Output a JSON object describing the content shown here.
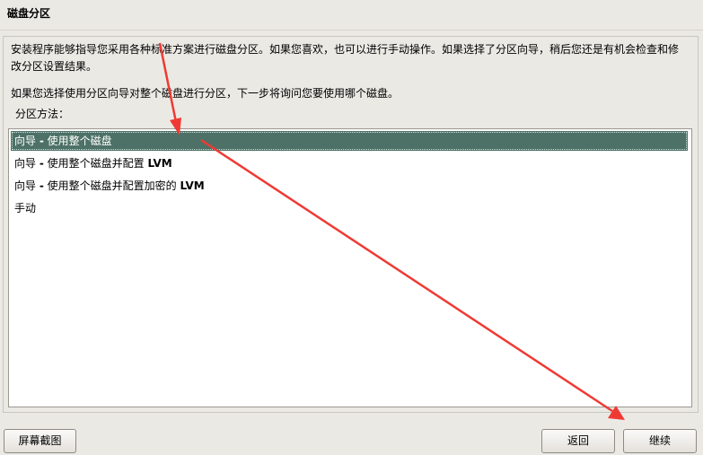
{
  "window": {
    "title": "磁盘分区"
  },
  "description": {
    "line1": "安装程序能够指导您采用各种标准方案进行磁盘分区。如果您喜欢，也可以进行手动操作。如果选择了分区向导，稍后您还是有机会检查和修",
    "line2": "改分区设置结果。",
    "line3": "如果您选择使用分区向导对整个磁盘进行分区，下一步将询问您要使用哪个磁盘。"
  },
  "method_label": "分区方法：",
  "options": [
    {
      "prefix": "向导 ",
      "dash": "-",
      "text": " 使用整个磁盘",
      "suffix": "",
      "selected": true
    },
    {
      "prefix": "向导 ",
      "dash": "-",
      "text": " 使用整个磁盘并配置 ",
      "suffix": "LVM",
      "selected": false
    },
    {
      "prefix": "向导 ",
      "dash": "-",
      "text": " 使用整个磁盘并配置加密的 ",
      "suffix": "LVM",
      "selected": false
    },
    {
      "prefix": "手动",
      "dash": "",
      "text": "",
      "suffix": "",
      "selected": false
    }
  ],
  "buttons": {
    "screenshot": "屏幕截图",
    "back": "返回",
    "continue": "继续"
  },
  "colors": {
    "selection": "#4d7166",
    "annotation_arrow": "#ef3a34"
  }
}
